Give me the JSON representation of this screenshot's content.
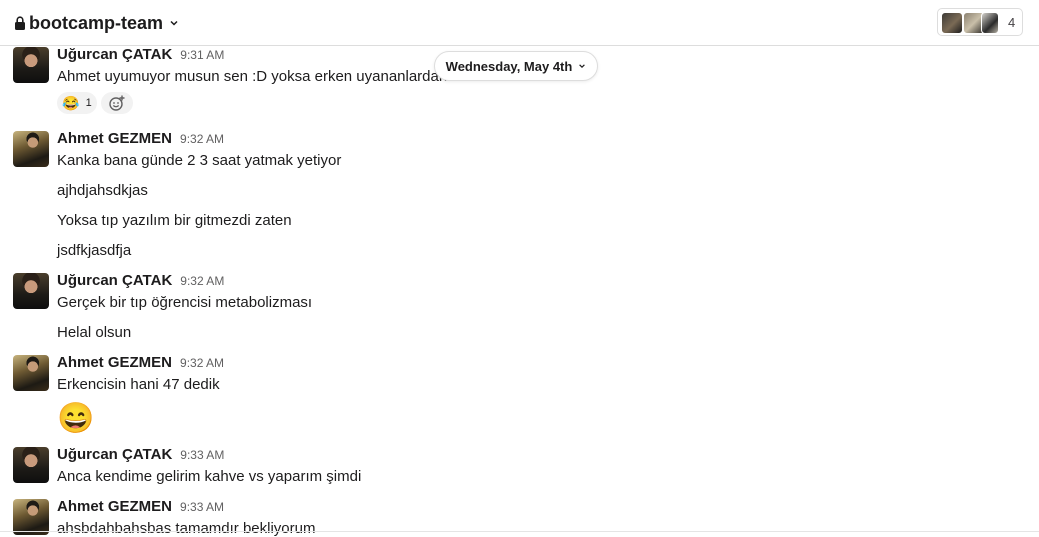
{
  "header": {
    "channel_name": "bootcamp-team",
    "member_count": "4"
  },
  "date_divider": {
    "label": "Wednesday, May 4th"
  },
  "messages": [
    {
      "sender": "Uğurcan ÇATAK",
      "time": "9:31 AM",
      "lines": [
        "Ahmet uyumuyor musun sen :D yoksa erken uyananlardan mısın"
      ],
      "reaction": {
        "emoji": "😂",
        "count": "1"
      }
    },
    {
      "sender": "Ahmet GEZMEN",
      "time": "9:32 AM",
      "lines": [
        "Kanka bana günde 2 3 saat yatmak yetiyor",
        "ajhdjahsdkjas",
        "Yoksa tıp yazılım bir gitmezdi zaten",
        "jsdfkjasdfja"
      ]
    },
    {
      "sender": "Uğurcan ÇATAK",
      "time": "9:32 AM",
      "lines": [
        "Gerçek bir tıp öğrencisi metabolizması",
        "Helal olsun"
      ]
    },
    {
      "sender": "Ahmet GEZMEN",
      "time": "9:32 AM",
      "lines": [
        "Erkencisin hani 47 dedik"
      ],
      "emoji": "😄"
    },
    {
      "sender": "Uğurcan ÇATAK",
      "time": "9:33 AM",
      "lines": [
        "Anca kendime gelirim kahve vs yaparım şimdi"
      ]
    },
    {
      "sender": "Ahmet GEZMEN",
      "time": "9:33 AM",
      "lines": [
        "ahsbdahbahsbas tamamdır bekliyorum"
      ]
    }
  ]
}
